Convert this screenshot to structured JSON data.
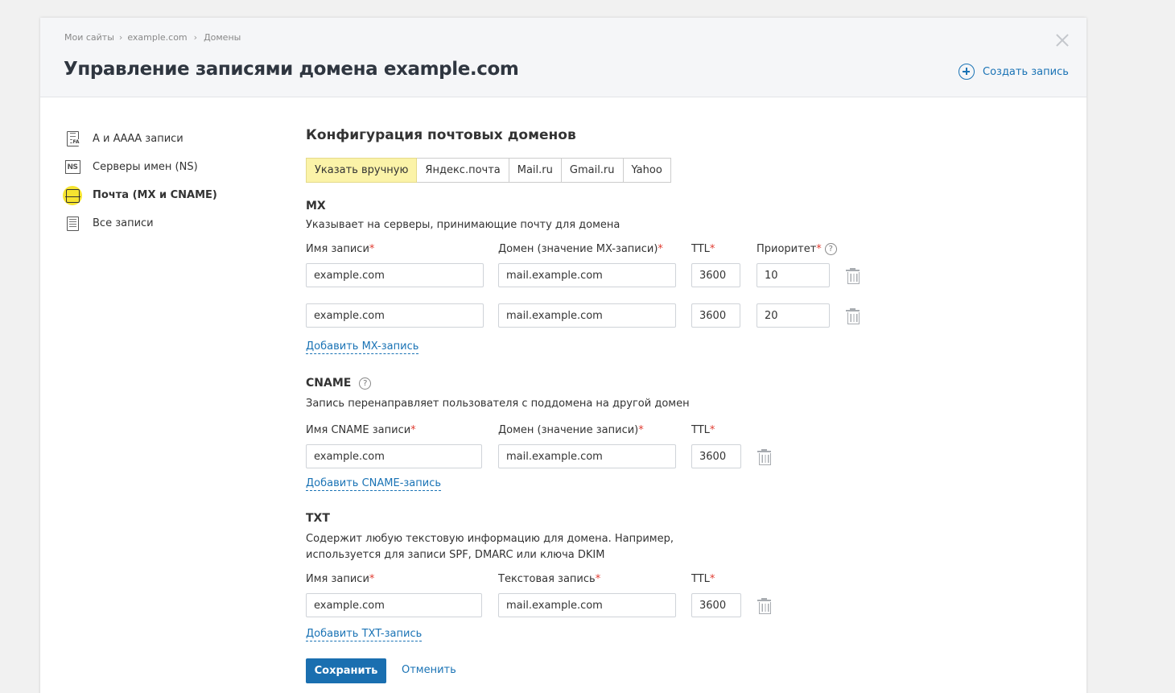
{
  "breadcrumb": [
    "Мои сайты",
    "example.com",
    "Домены"
  ],
  "title": "Управление записями домена example.com",
  "create_record": "Создать запись",
  "sidebar": {
    "items": [
      {
        "label": "А и АААА записи",
        "icon": "dns-a-record-icon"
      },
      {
        "label": "Серверы имен (NS)",
        "icon": "ns-icon",
        "icon_text": "NS"
      },
      {
        "label": "Почта (MX и CNAME)",
        "icon": "mail-icon",
        "active": true
      },
      {
        "label": "Все записи",
        "icon": "list-icon"
      }
    ]
  },
  "section_title": "Конфигурация почтовых доменов",
  "providers": [
    "Указать вручную",
    "Яндекс.почта",
    "Mail.ru",
    "Gmail.ru",
    "Yahoo"
  ],
  "active_provider": "Указать вручную",
  "mx": {
    "title": "MX",
    "description": "Указывает на серверы, принимающие почту для домена",
    "labels": {
      "name": "Имя записи",
      "domain": "Домен (значение MX-записи)",
      "ttl": "TTL",
      "priority": "Приоритет"
    },
    "rows": [
      {
        "name": "example.com",
        "domain": "mail.example.com",
        "ttl": "3600",
        "priority": "10"
      },
      {
        "name": "example.com",
        "domain": "mail.example.com",
        "ttl": "3600",
        "priority": "20"
      }
    ],
    "add_label": "Добавить MX-запись"
  },
  "cname": {
    "title": "CNAME",
    "description": "Запись перенаправляет пользователя с поддомена на другой домен",
    "labels": {
      "name": "Имя CNAME записи",
      "domain": "Домен (значение записи)",
      "ttl": "TTL"
    },
    "rows": [
      {
        "name": "example.com",
        "domain": "mail.example.com",
        "ttl": "3600"
      }
    ],
    "add_label": "Добавить CNAME-запись"
  },
  "txt": {
    "title": "TXT",
    "description_line1": "Содержит любую текстовую информацию для домена. Например,",
    "description_line2": "используется для записи SPF, DMARC или ключа DKIM",
    "labels": {
      "name": "Имя записи",
      "text": "Текстовая запись",
      "ttl": "TTL"
    },
    "rows": [
      {
        "name": "example.com",
        "text": "mail.example.com",
        "ttl": "3600"
      }
    ],
    "add_label": "Добавить TXT-запись"
  },
  "required_mark": "*",
  "help_mark": "?",
  "buttons": {
    "save": "Сохранить",
    "cancel": "Отменить"
  },
  "colors": {
    "accent": "#1a73b5",
    "primary_button": "#1a6fb0",
    "active_tab": "#fbf3a8",
    "active_icon": "#f6e430",
    "required": "#e03c31"
  }
}
